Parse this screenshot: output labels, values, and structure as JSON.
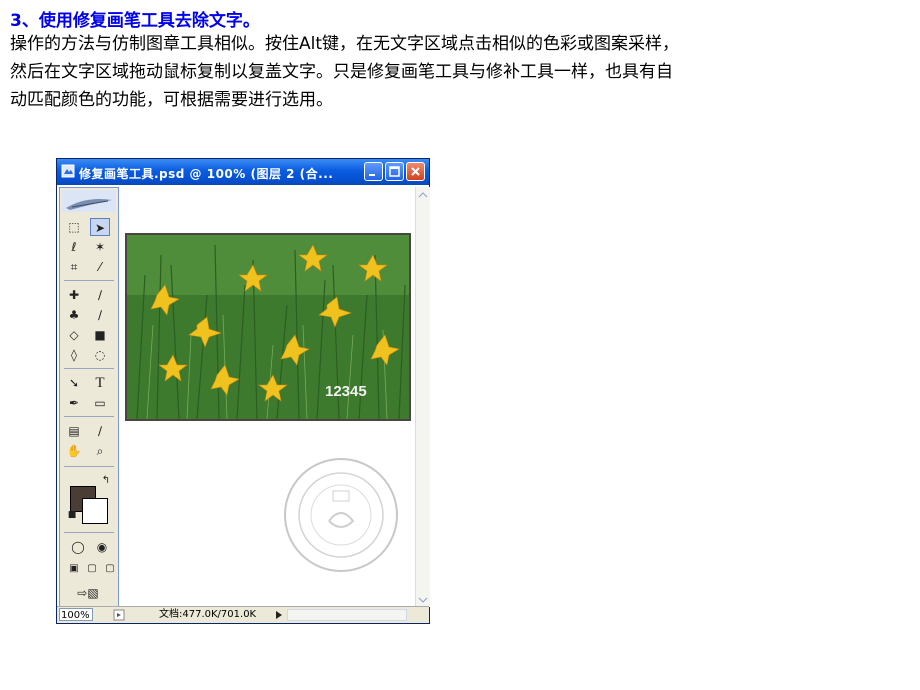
{
  "heading": "3、使用修复画笔工具去除文字。",
  "paragraph": [
    "操作的方法与仿制图章工具相似。按住Alt键，在无文字区域点击相似的色彩或图案采样，",
    "然后在文字区域拖动鼠标复制以复盖文字。只是修复画笔工具与修补工具一样，也具有自",
    "动匹配颜色的功能，可根据需要进行选用。"
  ],
  "window": {
    "title": "修复画笔工具.psd @ 100% (图层 2 (合...",
    "image_text": "12345",
    "zoom": "100%",
    "doc_info": "文档:477.0K/701.0K"
  },
  "colors": {
    "foreground": "#4a3e34",
    "background": "#ffffff",
    "titlebar": "#0a5ce0"
  }
}
